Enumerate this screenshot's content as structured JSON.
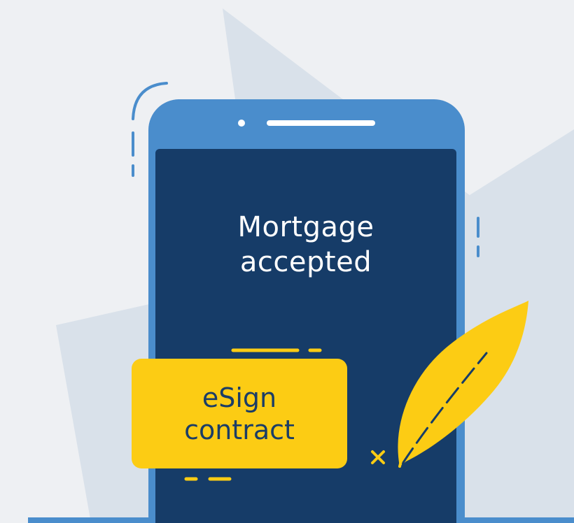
{
  "screen": {
    "title_line1": "Mortgage",
    "title_line2": "accepted"
  },
  "sign_card": {
    "line1": "eSign",
    "line2": "contract"
  },
  "colors": {
    "background": "#eef0f3",
    "background_shapes": "#d9e1ea",
    "phone_body": "#4a8dcc",
    "phone_screen": "#163c68",
    "accent_yellow": "#fccc14"
  },
  "icons": {
    "feather": "feather-quill-icon",
    "sign_mark": "x-mark-icon"
  }
}
